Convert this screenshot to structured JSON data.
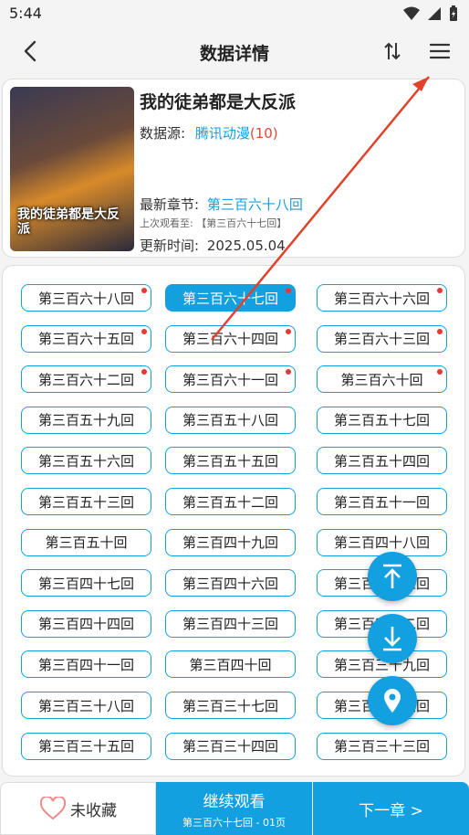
{
  "status": {
    "time": "5:44"
  },
  "header": {
    "title": "数据详情"
  },
  "comic": {
    "name": "我的徒弟都是大反派",
    "cover_text": "我的徒弟都是大反派",
    "source_label": "数据源:",
    "source_name": "腾讯动漫",
    "source_count": "(10)",
    "latest_label": "最新章节:",
    "latest_value": "第三百六十八回",
    "last_read": "上次观看至: 【第三百六十七回】",
    "update_label": "更新时间:",
    "update_value": "2025.05.04"
  },
  "chapters": [
    {
      "label": "第三百六十八回",
      "dot": true
    },
    {
      "label": "第三百六十七回",
      "dot": true,
      "selected": true
    },
    {
      "label": "第三百六十六回",
      "dot": true
    },
    {
      "label": "第三百六十五回",
      "dot": true
    },
    {
      "label": "第三百六十四回",
      "dot": true
    },
    {
      "label": "第三百六十三回",
      "dot": true
    },
    {
      "label": "第三百六十二回",
      "dot": true
    },
    {
      "label": "第三百六十一回",
      "dot": true
    },
    {
      "label": "第三百六十回",
      "dot": true
    },
    {
      "label": "第三百五十九回"
    },
    {
      "label": "第三百五十八回"
    },
    {
      "label": "第三百五十七回"
    },
    {
      "label": "第三百五十六回"
    },
    {
      "label": "第三百五十五回"
    },
    {
      "label": "第三百五十四回"
    },
    {
      "label": "第三百五十三回"
    },
    {
      "label": "第三百五十二回"
    },
    {
      "label": "第三百五十一回"
    },
    {
      "label": "第三百五十回"
    },
    {
      "label": "第三百四十九回"
    },
    {
      "label": "第三百四十八回"
    },
    {
      "label": "第三百四十七回"
    },
    {
      "label": "第三百四十六回"
    },
    {
      "label": "第三百四十五回"
    },
    {
      "label": "第三百四十四回"
    },
    {
      "label": "第三百四十三回"
    },
    {
      "label": "第三百四十二回"
    },
    {
      "label": "第三百四十一回"
    },
    {
      "label": "第三百四十回"
    },
    {
      "label": "第三百三十九回"
    },
    {
      "label": "第三百三十八回"
    },
    {
      "label": "第三百三十七回"
    },
    {
      "label": "第三百三十六回"
    },
    {
      "label": "第三百三十五回"
    },
    {
      "label": "第三百三十四回"
    },
    {
      "label": "第三百三十三回"
    }
  ],
  "bottom": {
    "favorite_label": "未收藏",
    "continue_label": "继续观看",
    "continue_sub": "第三百六十七回 - 01页",
    "next_label": "下一章 >"
  },
  "colors": {
    "accent": "#12a0e0",
    "dot": "#e53935",
    "annotation": "#e0432c"
  }
}
